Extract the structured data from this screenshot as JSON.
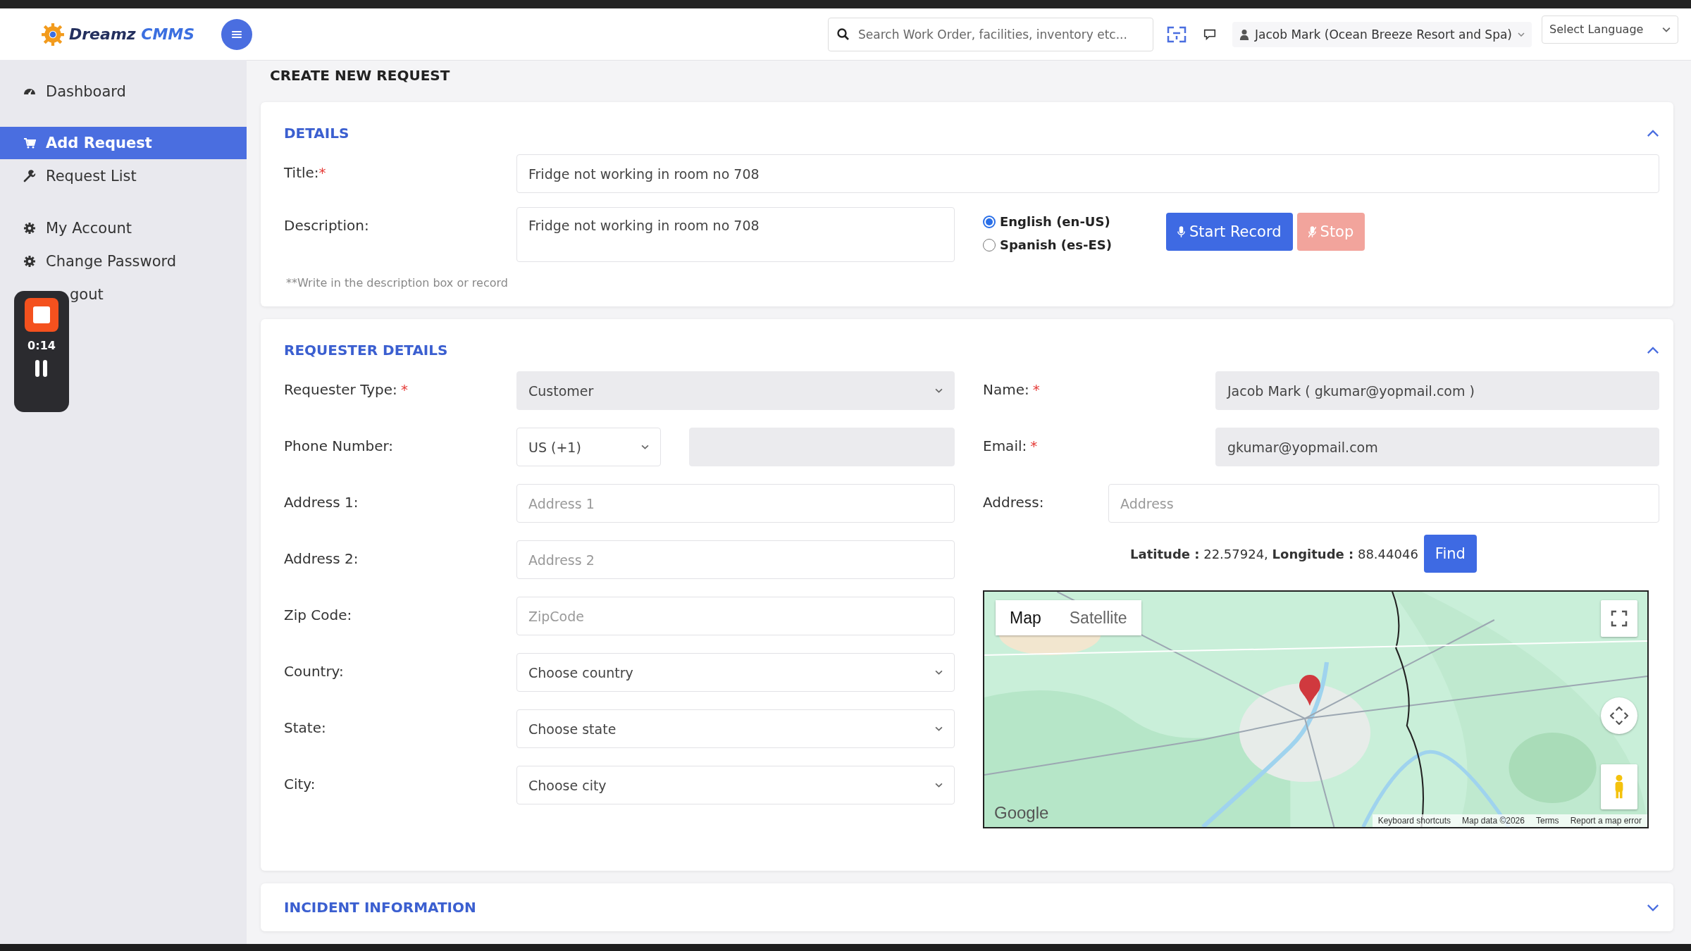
{
  "brand": {
    "name": "Dreamz",
    "suffix": "CMMS"
  },
  "topbar": {
    "search": {
      "placeholder": "Search Work Order, facilities, inventory etc..."
    },
    "user": "Jacob Mark (Ocean Breeze Resort and Spa)",
    "language": "Select Language"
  },
  "sidebar": {
    "items": [
      {
        "label": "Dashboard",
        "kind": "dashboard",
        "selected": false
      },
      {
        "label": "Add Request",
        "kind": "cart",
        "selected": true
      },
      {
        "label": "Request List",
        "kind": "wrench",
        "selected": false
      },
      {
        "label": "My Account",
        "kind": "gear",
        "selected": false
      },
      {
        "label": "Change Password",
        "kind": "gear",
        "selected": false
      },
      {
        "label": "gout",
        "kind": "covered",
        "selected": false
      }
    ]
  },
  "recorder": {
    "time": "0:14"
  },
  "page_title": "CREATE NEW REQUEST",
  "details": {
    "heading": "DETAILS",
    "expanded": true,
    "title": {
      "label": "Title:",
      "required_mark": "*",
      "value": "Fridge not working in room no 708"
    },
    "description": {
      "label": "Description:",
      "value": "Fridge not working in room no 708"
    },
    "hint": "**Write in the description box or record",
    "languages": [
      {
        "label": "English (en-US)",
        "selected": true
      },
      {
        "label": "Spanish (es-ES)",
        "selected": false
      }
    ],
    "buttons": [
      {
        "label": "Start Record",
        "kind": "record",
        "disabled": false
      },
      {
        "label": "Stop",
        "kind": "stop",
        "disabled": true
      }
    ]
  },
  "requester": {
    "heading": "REQUESTER DETAILS",
    "expanded": true,
    "left": [
      {
        "label": "Requester Type:",
        "required_mark": "*",
        "kind": "select",
        "value": "Customer",
        "readonly": true
      },
      {
        "label": "Phone Number:",
        "kind": "phone",
        "value": "US (+1)",
        "readonly": true
      },
      {
        "label": "Address 1:",
        "kind": "text",
        "placeholder": "Address 1",
        "readonly": false
      },
      {
        "label": "Address 2:",
        "kind": "text",
        "placeholder": "Address 2",
        "readonly": false
      },
      {
        "label": "Zip Code:",
        "kind": "text",
        "placeholder": "ZipCode",
        "readonly": false
      },
      {
        "label": "Country:",
        "kind": "select",
        "value": "Choose country",
        "readonly": false
      },
      {
        "label": "State:",
        "kind": "select",
        "value": "Choose state",
        "readonly": false
      },
      {
        "label": "City:",
        "kind": "select",
        "value": "Choose city",
        "readonly": false
      }
    ],
    "right": [
      {
        "label": "Name:",
        "required_mark": "*",
        "kind": "text",
        "value": "Jacob Mark ( gkumar@yopmail.com )",
        "readonly": true
      },
      {
        "label": "Email:",
        "required_mark": "*",
        "kind": "text",
        "value": "gkumar@yopmail.com",
        "readonly": true
      },
      {
        "label": "Address:",
        "kind": "compact",
        "placeholder": "Address",
        "readonly": false
      }
    ],
    "coordinates": "**Latitude :** 22.57924, **Longitude :** 88.44046",
    "find_button": "Find",
    "map": {
      "kind": "picture",
      "types": [
        {
          "label": "Map",
          "selected": true
        },
        {
          "label": "Satellite",
          "selected": false
        }
      ],
      "attribution": "Google",
      "footer": [
        "Keyboard shortcuts",
        "Map data ©2026",
        "Terms",
        "Report a map error"
      ]
    }
  },
  "incident": {
    "heading": "INCIDENT INFORMATION",
    "expanded": false
  }
}
